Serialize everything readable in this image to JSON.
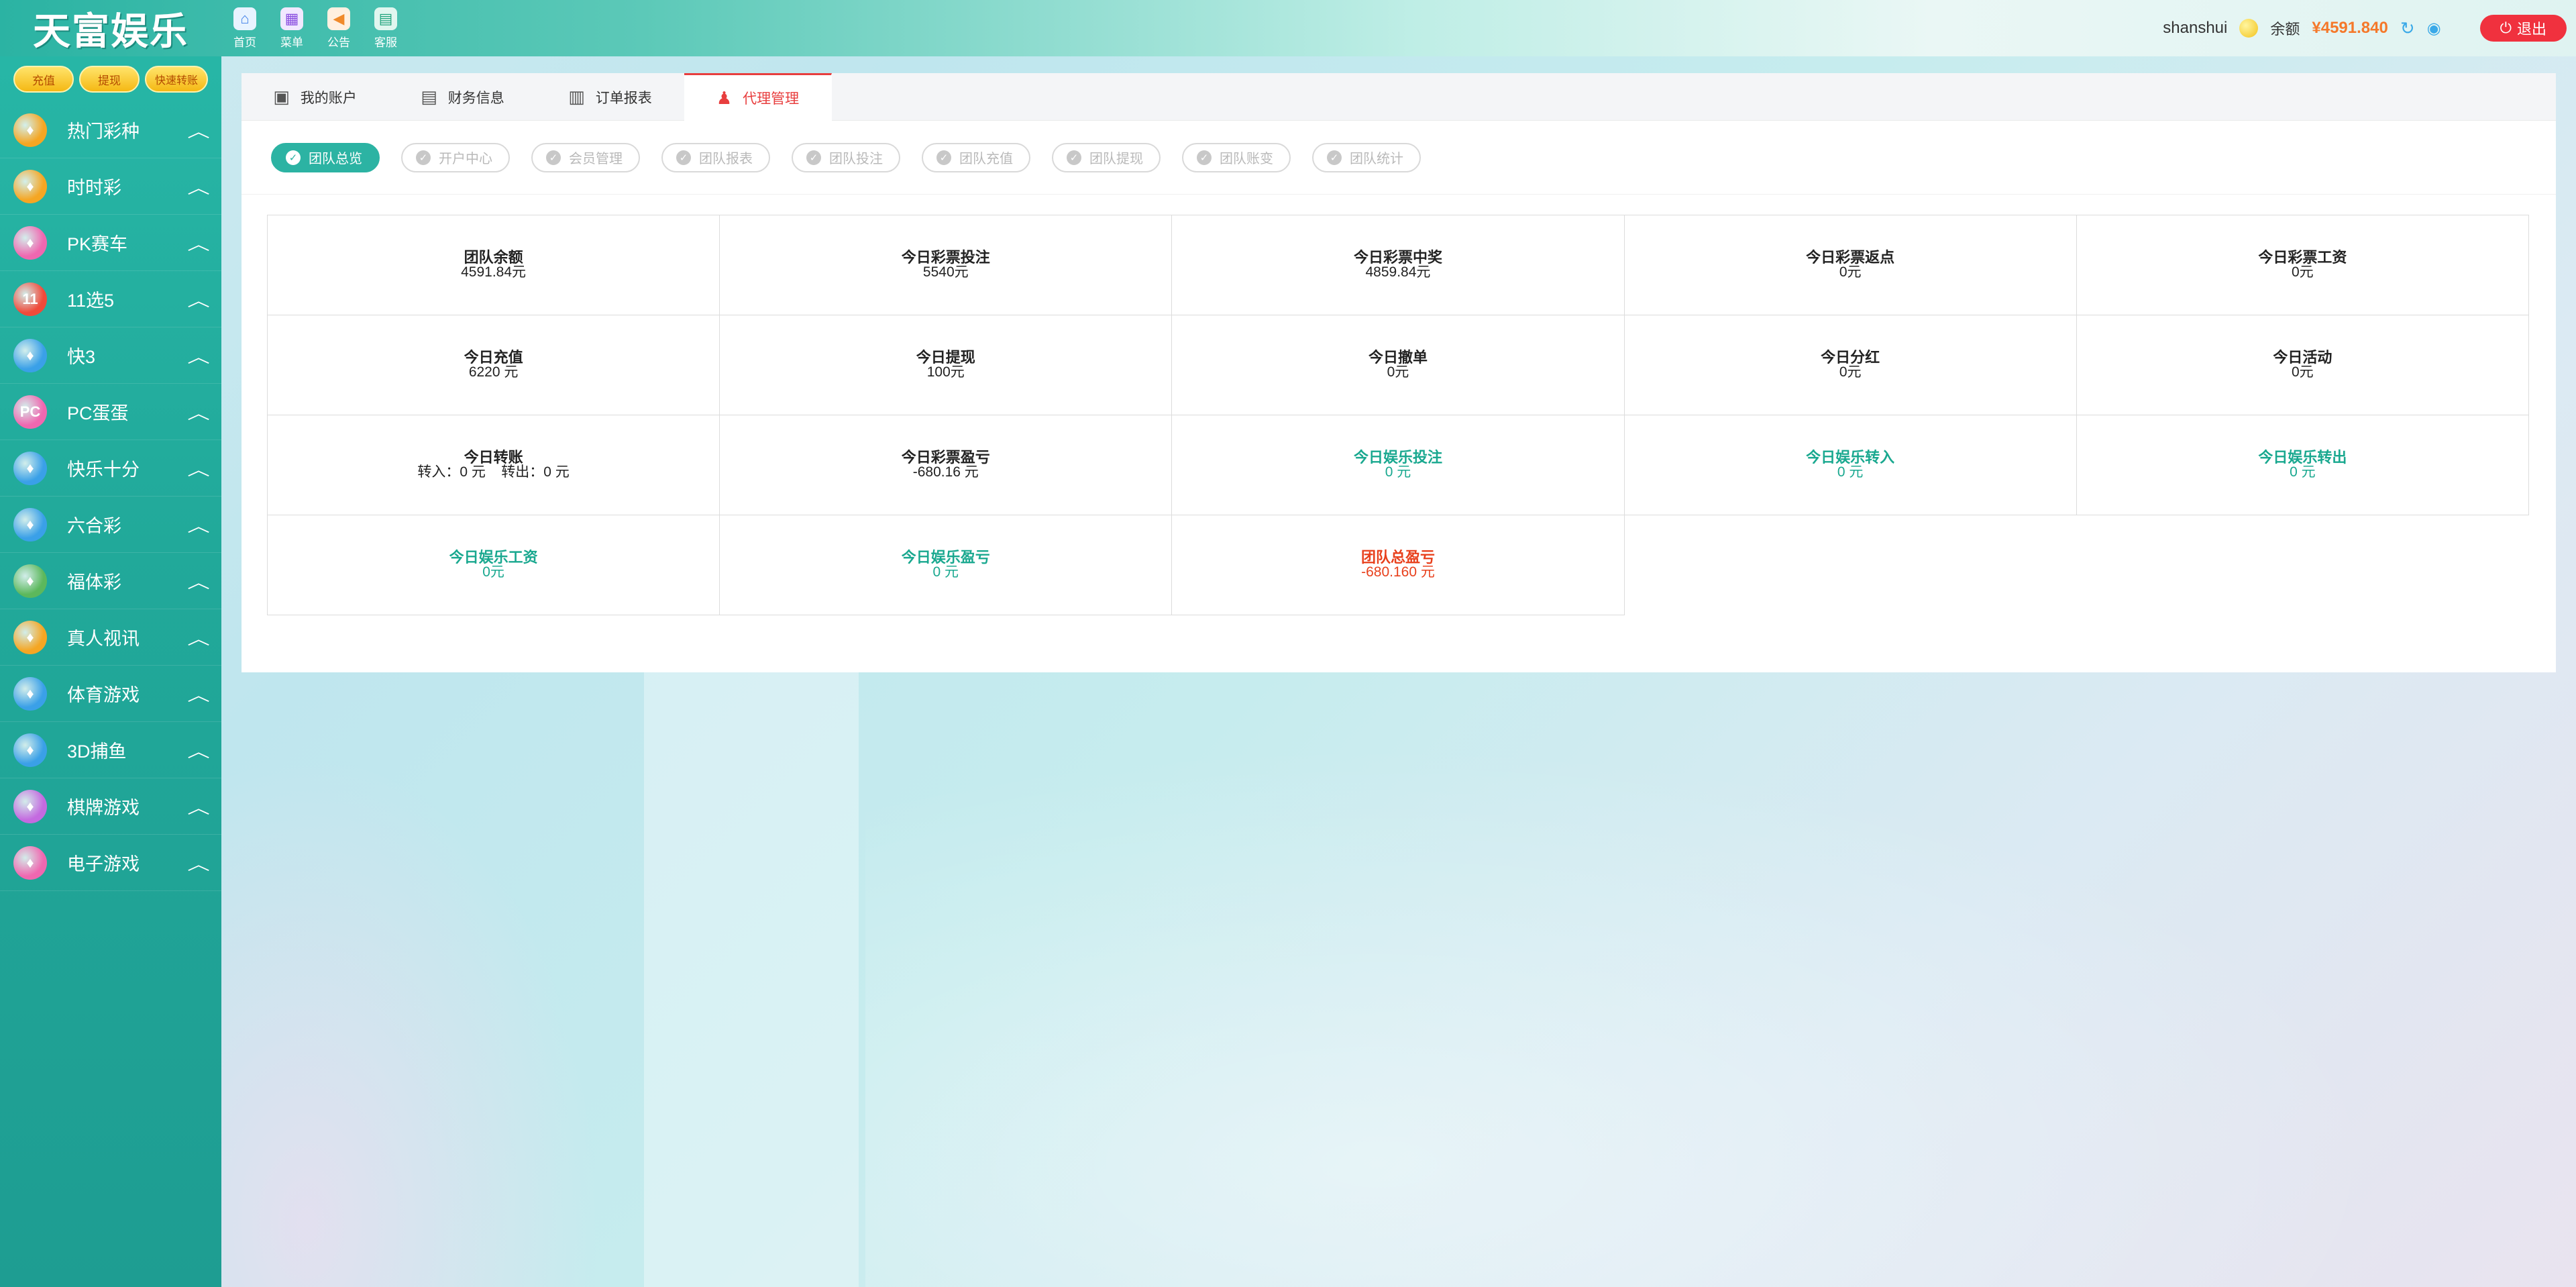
{
  "header": {
    "logo_text": "天富娱乐",
    "nav": [
      {
        "label": "首页",
        "icon": "home-icon"
      },
      {
        "label": "菜单",
        "icon": "grid-icon"
      },
      {
        "label": "公告",
        "icon": "megaphone-icon"
      },
      {
        "label": "客服",
        "icon": "chat-icon"
      }
    ],
    "username": "shanshui",
    "balance_label": "余额",
    "balance_value": "¥4591.840",
    "logout_label": "退出"
  },
  "sidebar": {
    "quick_buttons": [
      "充值",
      "提现",
      "快速转账"
    ],
    "items": [
      {
        "label": "热门彩种",
        "color": "#f5a623",
        "glyph": "♦"
      },
      {
        "label": "时时彩",
        "color": "#f5a623",
        "glyph": "♦"
      },
      {
        "label": "PK赛车",
        "color": "#f067b0",
        "glyph": "♦"
      },
      {
        "label": "11选5",
        "color": "#f04a3a",
        "glyph": "11"
      },
      {
        "label": "快3",
        "color": "#3aa0e8",
        "glyph": "♦"
      },
      {
        "label": "PC蛋蛋",
        "color": "#f067b0",
        "glyph": "PC"
      },
      {
        "label": "快乐十分",
        "color": "#3aa0e8",
        "glyph": "♦"
      },
      {
        "label": "六合彩",
        "color": "#3aa0e8",
        "glyph": "♦"
      },
      {
        "label": "福体彩",
        "color": "#5cb85c",
        "glyph": "♦"
      },
      {
        "label": "真人视讯",
        "color": "#f5a623",
        "glyph": "♦"
      },
      {
        "label": "体育游戏",
        "color": "#3aa0e8",
        "glyph": "♦"
      },
      {
        "label": "3D捕鱼",
        "color": "#3aa0e8",
        "glyph": "♦"
      },
      {
        "label": "棋牌游戏",
        "color": "#c46ae0",
        "glyph": "♦"
      },
      {
        "label": "电子游戏",
        "color": "#f067b0",
        "glyph": "♦"
      }
    ]
  },
  "tabs": [
    {
      "label": "我的账户",
      "icon": "wallet-icon",
      "active": false
    },
    {
      "label": "财务信息",
      "icon": "safe-icon",
      "active": false
    },
    {
      "label": "订单报表",
      "icon": "document-icon",
      "active": false
    },
    {
      "label": "代理管理",
      "icon": "agent-icon",
      "active": true
    }
  ],
  "subtabs": [
    {
      "label": "团队总览",
      "active": true
    },
    {
      "label": "开户中心",
      "active": false
    },
    {
      "label": "会员管理",
      "active": false
    },
    {
      "label": "团队报表",
      "active": false
    },
    {
      "label": "团队投注",
      "active": false
    },
    {
      "label": "团队充值",
      "active": false
    },
    {
      "label": "团队提现",
      "active": false
    },
    {
      "label": "团队账变",
      "active": false
    },
    {
      "label": "团队统计",
      "active": false
    }
  ],
  "stats": {
    "row1": [
      {
        "title": "团队余额",
        "value": "4591.84元"
      },
      {
        "title": "今日彩票投注",
        "value": "5540元"
      },
      {
        "title": "今日彩票中奖",
        "value": "4859.84元"
      },
      {
        "title": "今日彩票返点",
        "value": "0元"
      },
      {
        "title": "今日彩票工资",
        "value": "0元"
      }
    ],
    "row2": [
      {
        "title": "今日充值",
        "value": "6220 元"
      },
      {
        "title": "今日提现",
        "value": "100元"
      },
      {
        "title": "今日撤单",
        "value": "0元"
      },
      {
        "title": "今日分红",
        "value": "0元"
      },
      {
        "title": "今日活动",
        "value": "0元"
      }
    ],
    "row3": [
      {
        "title": "今日转账",
        "value": "转入：0 元    转出：0 元"
      },
      {
        "title": "今日彩票盈亏",
        "value": "-680.16 元"
      },
      {
        "title": "今日娱乐投注",
        "value": "0 元"
      },
      {
        "title": "今日娱乐转入",
        "value": "0 元"
      },
      {
        "title": "今日娱乐转出",
        "value": "0 元"
      }
    ],
    "row4": [
      {
        "title": "今日娱乐工资",
        "value": "0元"
      },
      {
        "title": "今日娱乐盈亏",
        "value": "0 元"
      },
      {
        "title": "团队总盈亏",
        "value": "-680.160 元"
      }
    ]
  }
}
